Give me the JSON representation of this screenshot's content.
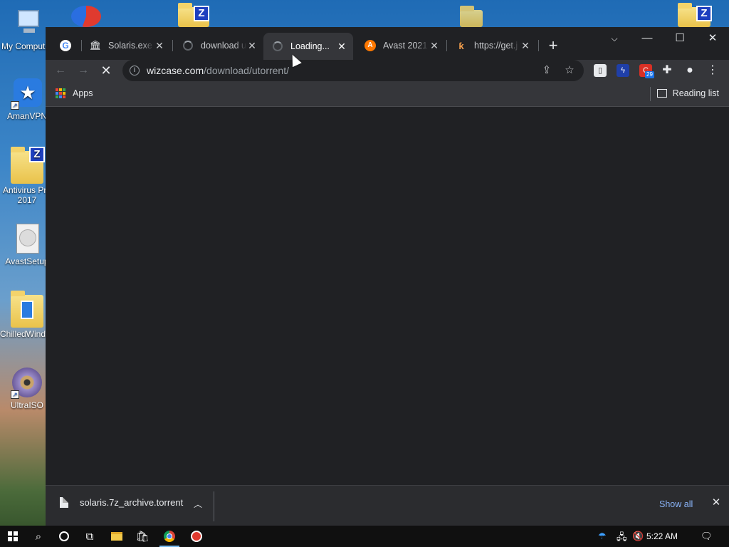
{
  "desktop": {
    "icons": [
      {
        "label": "My Computer"
      },
      {
        "label": "AmanVPN"
      },
      {
        "label": "Antivirus Pro",
        "label2": "2017"
      },
      {
        "label": "AvastSetup"
      },
      {
        "label": "ChilledWindows"
      },
      {
        "label": "UltraISO"
      }
    ]
  },
  "browser": {
    "tabs": [
      {
        "title": "",
        "icon": "google-icon"
      },
      {
        "title": "Solaris.exe",
        "icon": "bank-icon"
      },
      {
        "title": "download u",
        "icon": "loading-spinner"
      },
      {
        "title": "Loading...",
        "icon": "loading-spinner",
        "active": true
      },
      {
        "title": "Avast 2021",
        "icon": "avast-icon"
      },
      {
        "title": "https://get.j",
        "icon": "site-icon"
      }
    ],
    "address": {
      "host": "wizcase.com",
      "path": "/download/utorrent/"
    },
    "extension_badge": "29",
    "bookmarks": {
      "apps_label": "Apps",
      "reading_list_label": "Reading list"
    },
    "download_shelf": {
      "file_name": "solaris.7z_archive.torrent",
      "show_all_label": "Show all"
    }
  },
  "taskbar": {
    "clock": "5:22 AM"
  },
  "colors": {
    "accent_link": "#8ab4f8",
    "chrome_dark": "#202124",
    "toolbar": "#35363a"
  }
}
